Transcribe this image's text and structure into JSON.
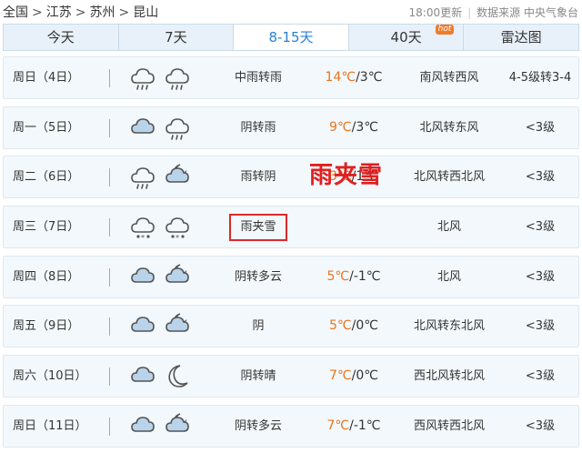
{
  "breadcrumb": {
    "items": [
      "全国",
      "江苏",
      "苏州",
      "昆山"
    ],
    "sep": ">"
  },
  "meta": {
    "update_time": "18:00更新",
    "source_label": "数据来源 中央气象台"
  },
  "tabs": [
    {
      "label": "今天",
      "active": false,
      "hot": false
    },
    {
      "label": "7天",
      "active": false,
      "hot": false
    },
    {
      "label": "8-15天",
      "active": true,
      "hot": false
    },
    {
      "label": "40天",
      "active": false,
      "hot": true,
      "badge": "hot"
    },
    {
      "label": "雷达图",
      "active": false,
      "hot": false
    }
  ],
  "forecast": [
    {
      "day": "周日（4日）",
      "icons": [
        "rain-cloud-icon",
        "rain-cloud-icon"
      ],
      "desc": "中雨转雨",
      "high": "14℃",
      "low": "/3℃",
      "wind": "南风转西风",
      "level": "4-5级转3-4"
    },
    {
      "day": "周一（5日）",
      "icons": [
        "cloud-icon",
        "rain-cloud-icon"
      ],
      "desc": "阴转雨",
      "high": "9℃",
      "low": "/3℃",
      "wind": "北风转东风",
      "level": "<3级"
    },
    {
      "day": "周二（6日）",
      "icons": [
        "rain-cloud-icon",
        "moon-cloud-icon"
      ],
      "desc": "雨转阴",
      "high": "3℃",
      "low": "/1℃",
      "wind": "北风转西北风",
      "level": "<3级"
    },
    {
      "day": "周三（7日）",
      "icons": [
        "sleet-cloud-icon",
        "sleet-cloud-icon"
      ],
      "desc": "雨夹雪",
      "high": "",
      "low": "",
      "wind": "北风",
      "level": "<3级"
    },
    {
      "day": "周四（8日）",
      "icons": [
        "cloud-icon",
        "moon-cloud-icon"
      ],
      "desc": "阴转多云",
      "high": "5℃",
      "low": "/-1℃",
      "wind": "北风",
      "level": "<3级"
    },
    {
      "day": "周五（9日）",
      "icons": [
        "cloud-icon",
        "moon-cloud-icon"
      ],
      "desc": "阴",
      "high": "5℃",
      "low": "/0℃",
      "wind": "北风转东北风",
      "level": "<3级"
    },
    {
      "day": "周六（10日）",
      "icons": [
        "cloud-icon",
        "moon-icon"
      ],
      "desc": "阴转晴",
      "high": "7℃",
      "low": "/0℃",
      "wind": "西北风转北风",
      "level": "<3级"
    },
    {
      "day": "周日（11日）",
      "icons": [
        "cloud-icon",
        "moon-cloud-icon"
      ],
      "desc": "阴转多云",
      "high": "7℃",
      "low": "/-1℃",
      "wind": "西风转西北风",
      "level": "<3级"
    }
  ],
  "annotation": "雨夹雪",
  "colors": {
    "accent": "#2a7fd4",
    "temp_high": "#e8741e",
    "highlight": "#e02020",
    "row_bg": "#f3f8fc"
  }
}
